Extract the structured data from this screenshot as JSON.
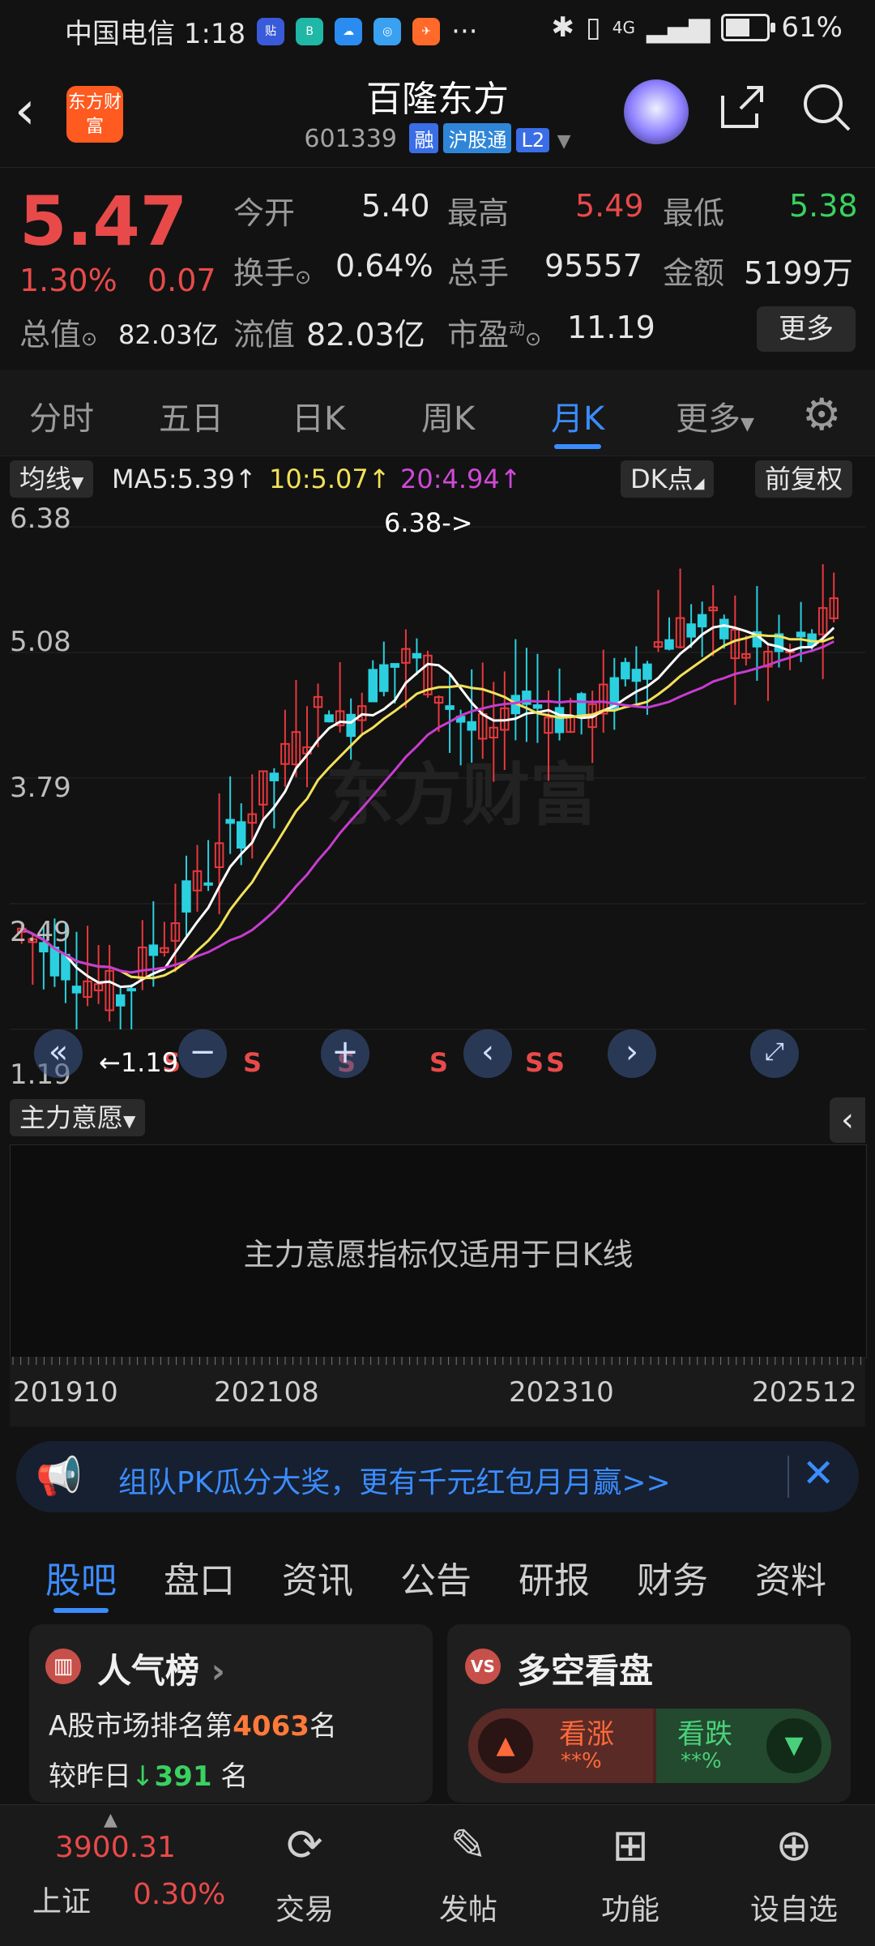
{
  "status_bar": {
    "carrier_time": "中国电信 1:18",
    "more": "···",
    "battery": "61%",
    "battery_level": 0.61,
    "net": "4G"
  },
  "header": {
    "logo_text": "东方财富",
    "title": "百隆东方",
    "code": "601339",
    "tags": [
      "融",
      "沪股通",
      "L2"
    ]
  },
  "quote": {
    "price": "5.47",
    "change_pct": "1.30%",
    "change_amt": "0.07",
    "open_label": "今开",
    "open": "5.40",
    "high_label": "最高",
    "high": "5.49",
    "low_label": "最低",
    "low": "5.38",
    "turnover_label": "换手",
    "turnover": "0.64%",
    "volume_label": "总手",
    "volume": "95557",
    "amount_label": "金额",
    "amount": "5199万",
    "total_cap_label": "总值",
    "total_cap": "82.03亿",
    "float_cap_label": "流值",
    "float_cap": "82.03亿",
    "pe_label": "市盈",
    "pe_sup": "动",
    "pe": "11.19",
    "more_label": "更多"
  },
  "tabs": [
    "分时",
    "五日",
    "日K",
    "周K",
    "月K",
    "更多"
  ],
  "indicator": {
    "type_label": "均线",
    "ma5": "MA5:5.39",
    "ma10": "10:5.07",
    "ma20": "20:4.94",
    "dk_label": "DK点",
    "adjust_label": "前复权"
  },
  "chart_data": {
    "type": "candlestick",
    "y_ticks": [
      "6.38",
      "5.08",
      "3.79",
      "2.49",
      "1.19"
    ],
    "ylim": [
      1.19,
      6.38
    ],
    "high_annotation": "6.38->",
    "low_annotation": "1.19",
    "x_ticks": [
      "201910",
      "202108",
      "202310",
      "202512"
    ],
    "watermark": "东方财富",
    "colors": {
      "up": "#e8383d",
      "down": "#2ad0e0",
      "ma5": "#ffffff",
      "ma10": "#f2e15a",
      "ma20": "#c83cd0"
    }
  },
  "main_power": {
    "label": "主力意愿",
    "message": "主力意愿指标仅适用于日K线"
  },
  "notice": {
    "text": "组队PK瓜分大奖，更有千元红包月月赢>>"
  },
  "bottom_tabs": [
    "股吧",
    "盘口",
    "资讯",
    "公告",
    "研报",
    "财务",
    "资料"
  ],
  "popularity": {
    "title": "人气榜",
    "rank_prefix": "A股市场排名第",
    "rank": "4063",
    "rank_suffix": "名",
    "vs_prefix": "较昨日",
    "vs_change": "391",
    "vs_suffix": "名"
  },
  "bull_bear": {
    "title": "多空看盘",
    "bull_label": "看涨",
    "bull_value": "**%",
    "bear_label": "看跌",
    "bear_value": "**%"
  },
  "bottom_bar": {
    "index_value": "3900.31",
    "index_name": "上证",
    "index_change": "0.30%",
    "items": [
      "交易",
      "发帖",
      "功能",
      "设自选"
    ]
  }
}
